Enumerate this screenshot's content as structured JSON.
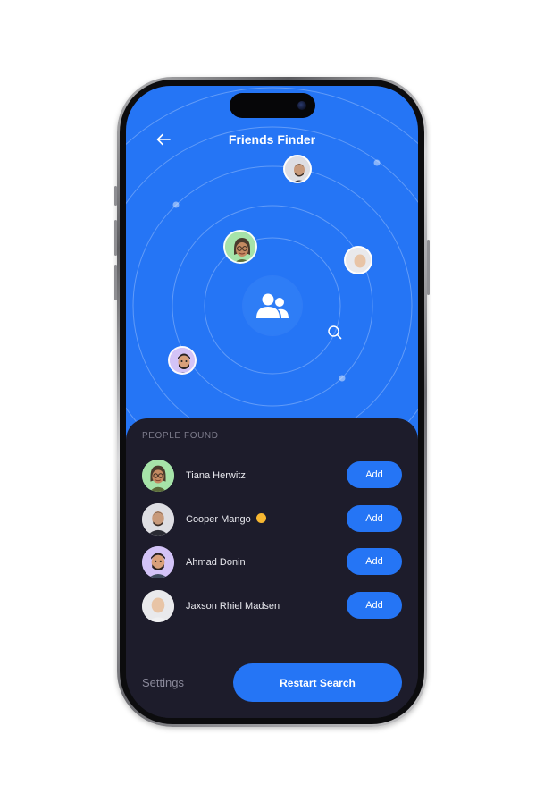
{
  "header": {
    "title": "Friends Finder",
    "back_icon": "arrow-left-icon"
  },
  "radar": {
    "center_icon": "users-icon",
    "search_icon": "search-icon"
  },
  "people_found": {
    "label": "PEOPLE FOUND",
    "people": [
      {
        "name": "Tiana Herwitz",
        "add_label": "Add",
        "avatar_bg": "#a6e3a9"
      },
      {
        "name": "Cooper Mango",
        "add_label": "Add",
        "avatar_bg": "#e6e6ea",
        "emoji": "upside-down-face"
      },
      {
        "name": "Ahmad Donin",
        "add_label": "Add",
        "avatar_bg": "#c9b8f5"
      },
      {
        "name": "Jaxson Rhiel Madsen",
        "add_label": "Add",
        "avatar_bg": "#ececef"
      }
    ]
  },
  "footer": {
    "settings_label": "Settings",
    "restart_label": "Restart Search"
  },
  "colors": {
    "accent": "#2575f5",
    "panel": "#1d1c2b"
  }
}
